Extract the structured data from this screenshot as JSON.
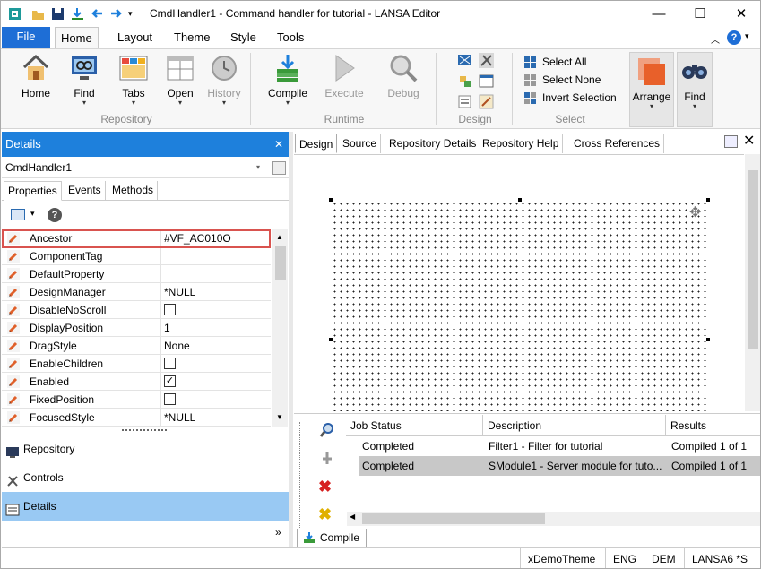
{
  "window": {
    "title": "CmdHandler1 - Command handler for tutorial - LANSA Editor",
    "minimize": "—",
    "maximize": "☐",
    "close": "✕"
  },
  "ribbon_tabs": {
    "file": "File",
    "home": "Home",
    "layout": "Layout",
    "theme": "Theme",
    "style": "Style",
    "tools": "Tools"
  },
  "ribbon": {
    "repository_group": "Repository",
    "runtime_group": "Runtime",
    "design_group": "Design",
    "select_group": "Select",
    "home": "Home",
    "find": "Find",
    "tabs": "Tabs",
    "open": "Open",
    "history": "History",
    "compile": "Compile",
    "execute": "Execute",
    "debug": "Debug",
    "select_all": "Select All",
    "select_none": "Select None",
    "invert_selection": "Invert Selection",
    "arrange": "Arrange",
    "find2": "Find"
  },
  "details": {
    "title": "Details",
    "close": "✕",
    "component": "CmdHandler1",
    "tabs": {
      "properties": "Properties",
      "events": "Events",
      "methods": "Methods"
    },
    "rows": [
      {
        "name": "Ancestor",
        "value": "#VF_AC010O"
      },
      {
        "name": "ComponentTag",
        "value": ""
      },
      {
        "name": "DefaultProperty",
        "value": ""
      },
      {
        "name": "DesignManager",
        "value": "*NULL"
      },
      {
        "name": "DisableNoScroll",
        "value": ""
      },
      {
        "name": "DisplayPosition",
        "value": "1"
      },
      {
        "name": "DragStyle",
        "value": "None"
      },
      {
        "name": "EnableChildren",
        "value": ""
      },
      {
        "name": "Enabled",
        "value": "✓"
      },
      {
        "name": "FixedPosition",
        "value": ""
      },
      {
        "name": "FocusedStyle",
        "value": "*NULL"
      }
    ]
  },
  "nav": {
    "repository": "Repository",
    "controls": "Controls",
    "details": "Details",
    "more": "»"
  },
  "right_tabs": {
    "design": "Design",
    "source": "Source",
    "repository_details": "Repository Details",
    "repository_help": "Repository Help",
    "cross_references": "Cross References"
  },
  "jobs": {
    "headers": {
      "status": "Job Status",
      "description": "Description",
      "results": "Results"
    },
    "rows": [
      {
        "status": "Completed",
        "description": "Filter1 - Filter for tutorial",
        "results": "Compiled 1 of 1"
      },
      {
        "status": "Completed",
        "description": "SModule1 - Server module for tuto...",
        "results": "Compiled 1 of 1"
      }
    ],
    "compile_tab": "Compile"
  },
  "statusbar": {
    "theme": "xDemoTheme",
    "lang": "ENG",
    "partition": "DEM",
    "system": "LANSA6 *S"
  }
}
